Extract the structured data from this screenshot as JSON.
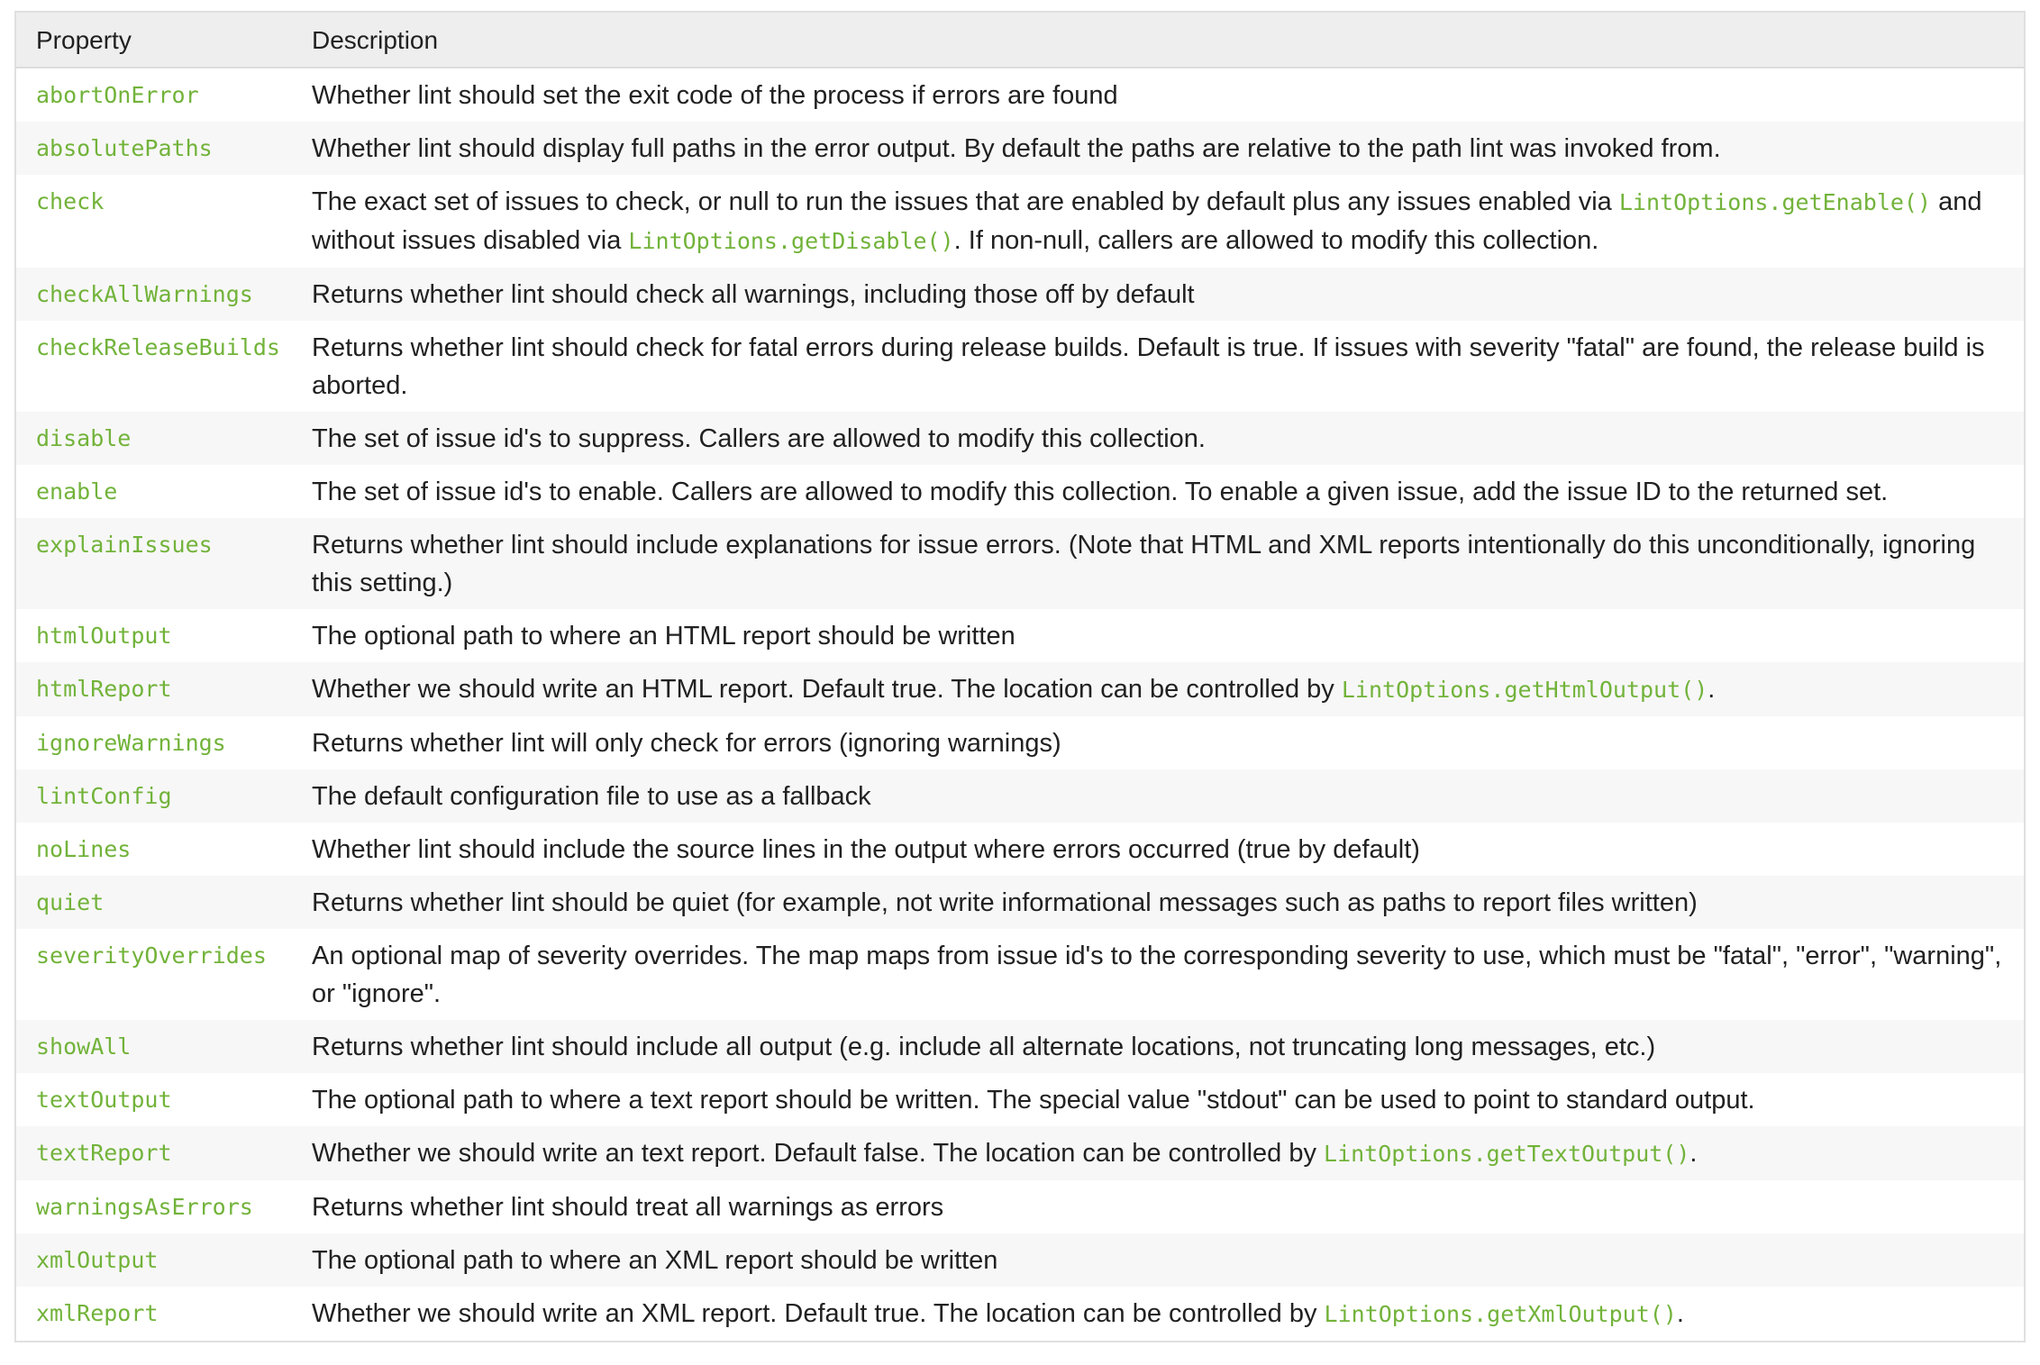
{
  "table": {
    "headers": {
      "property": "Property",
      "description": "Description"
    },
    "rows": [
      {
        "property": "abortOnError",
        "description": [
          {
            "text": "Whether lint should set the exit code of the process if errors are found"
          }
        ]
      },
      {
        "property": "absolutePaths",
        "description": [
          {
            "text": "Whether lint should display full paths in the error output. By default the paths are relative to the path lint was invoked from."
          }
        ]
      },
      {
        "property": "check",
        "description": [
          {
            "text": "The exact set of issues to check, or null to run the issues that are enabled by default plus any issues enabled via "
          },
          {
            "code": "LintOptions.getEnable()"
          },
          {
            "text": " and without issues disabled via "
          },
          {
            "code": "LintOptions.getDisable()"
          },
          {
            "text": ". If non-null, callers are allowed to modify this collection."
          }
        ]
      },
      {
        "property": "checkAllWarnings",
        "description": [
          {
            "text": "Returns whether lint should check all warnings, including those off by default"
          }
        ]
      },
      {
        "property": "checkReleaseBuilds",
        "description": [
          {
            "text": "Returns whether lint should check for fatal errors during release builds. Default is true. If issues with severity \"fatal\" are found, the release build is aborted."
          }
        ]
      },
      {
        "property": "disable",
        "description": [
          {
            "text": "The set of issue id's to suppress. Callers are allowed to modify this collection."
          }
        ]
      },
      {
        "property": "enable",
        "description": [
          {
            "text": "The set of issue id's to enable. Callers are allowed to modify this collection. To enable a given issue, add the issue ID to the returned set."
          }
        ]
      },
      {
        "property": "explainIssues",
        "description": [
          {
            "text": "Returns whether lint should include explanations for issue errors. (Note that HTML and XML reports intentionally do this unconditionally, ignoring this setting.)"
          }
        ]
      },
      {
        "property": "htmlOutput",
        "description": [
          {
            "text": "The optional path to where an HTML report should be written"
          }
        ]
      },
      {
        "property": "htmlReport",
        "description": [
          {
            "text": "Whether we should write an HTML report. Default true. The location can be controlled by "
          },
          {
            "code": "LintOptions.getHtmlOutput()"
          },
          {
            "text": "."
          }
        ]
      },
      {
        "property": "ignoreWarnings",
        "description": [
          {
            "text": "Returns whether lint will only check for errors (ignoring warnings)"
          }
        ]
      },
      {
        "property": "lintConfig",
        "description": [
          {
            "text": "The default configuration file to use as a fallback"
          }
        ]
      },
      {
        "property": "noLines",
        "description": [
          {
            "text": "Whether lint should include the source lines in the output where errors occurred (true by default)"
          }
        ]
      },
      {
        "property": "quiet",
        "description": [
          {
            "text": "Returns whether lint should be quiet (for example, not write informational messages such as paths to report files written)"
          }
        ]
      },
      {
        "property": "severityOverrides",
        "description": [
          {
            "text": "An optional map of severity overrides. The map maps from issue id's to the corresponding severity to use, which must be \"fatal\", \"error\", \"warning\", or \"ignore\"."
          }
        ]
      },
      {
        "property": "showAll",
        "description": [
          {
            "text": "Returns whether lint should include all output (e.g. include all alternate locations, not truncating long messages, etc.)"
          }
        ]
      },
      {
        "property": "textOutput",
        "description": [
          {
            "text": "The optional path to where a text report should be written. The special value \"stdout\" can be used to point to standard output."
          }
        ]
      },
      {
        "property": "textReport",
        "description": [
          {
            "text": "Whether we should write an text report. Default false. The location can be controlled by "
          },
          {
            "code": "LintOptions.getTextOutput()"
          },
          {
            "text": "."
          }
        ]
      },
      {
        "property": "warningsAsErrors",
        "description": [
          {
            "text": "Returns whether lint should treat all warnings as errors"
          }
        ]
      },
      {
        "property": "xmlOutput",
        "description": [
          {
            "text": "The optional path to where an XML report should be written"
          }
        ]
      },
      {
        "property": "xmlReport",
        "description": [
          {
            "text": "Whether we should write an XML report. Default true. The location can be controlled by "
          },
          {
            "code": "LintOptions.getXmlOutput()"
          },
          {
            "text": "."
          }
        ]
      }
    ]
  },
  "colors": {
    "code_green": "#72b33a",
    "header_bg": "#eeeeee",
    "row_stripe": "#f7f7f7",
    "border": "#e0e0e0"
  }
}
